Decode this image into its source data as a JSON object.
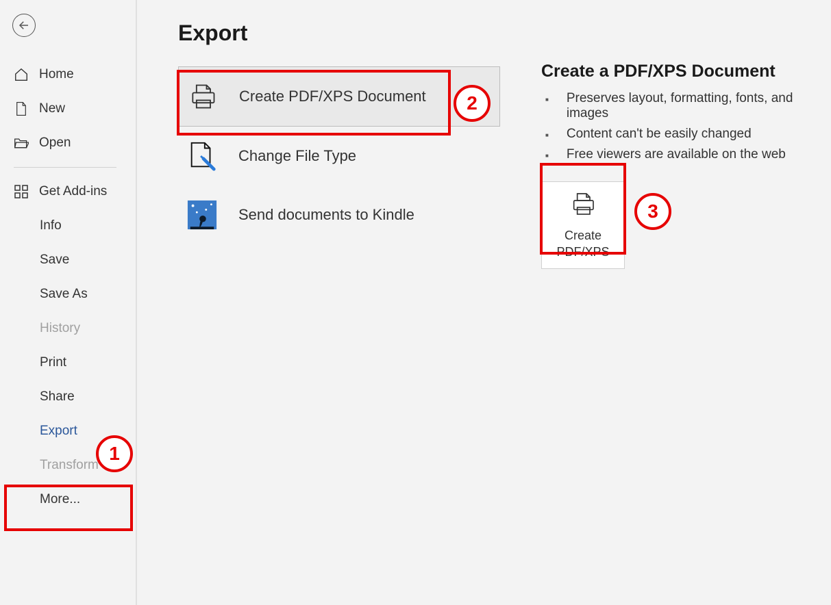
{
  "sidebar": {
    "items_top": [
      {
        "label": "Home"
      },
      {
        "label": "New"
      },
      {
        "label": "Open"
      }
    ],
    "items_mid": [
      {
        "label": "Get Add-ins"
      }
    ],
    "items_bottom": [
      {
        "label": "Info",
        "active": false
      },
      {
        "label": "Save",
        "active": false
      },
      {
        "label": "Save As",
        "active": false
      },
      {
        "label": "History",
        "disabled": true
      },
      {
        "label": "Print",
        "active": false
      },
      {
        "label": "Share",
        "active": false
      },
      {
        "label": "Export",
        "active": true
      },
      {
        "label": "Transform",
        "disabled": true
      },
      {
        "label": "More...",
        "active": false
      }
    ]
  },
  "page": {
    "title": "Export",
    "options": [
      {
        "label": "Create PDF/XPS Document",
        "selected": true
      },
      {
        "label": "Change File Type"
      },
      {
        "label": "Send documents to Kindle"
      }
    ],
    "detail": {
      "title": "Create a PDF/XPS Document",
      "bullets": [
        "Preserves layout, formatting, fonts, and images",
        "Content can't be easily changed",
        "Free viewers are available on the web"
      ],
      "action_label": "Create\nPDF/XPS"
    }
  },
  "annotations": {
    "callout1": "1",
    "callout2": "2",
    "callout3": "3"
  },
  "colors": {
    "accent": "#2b579a",
    "annotation": "#e60000"
  }
}
